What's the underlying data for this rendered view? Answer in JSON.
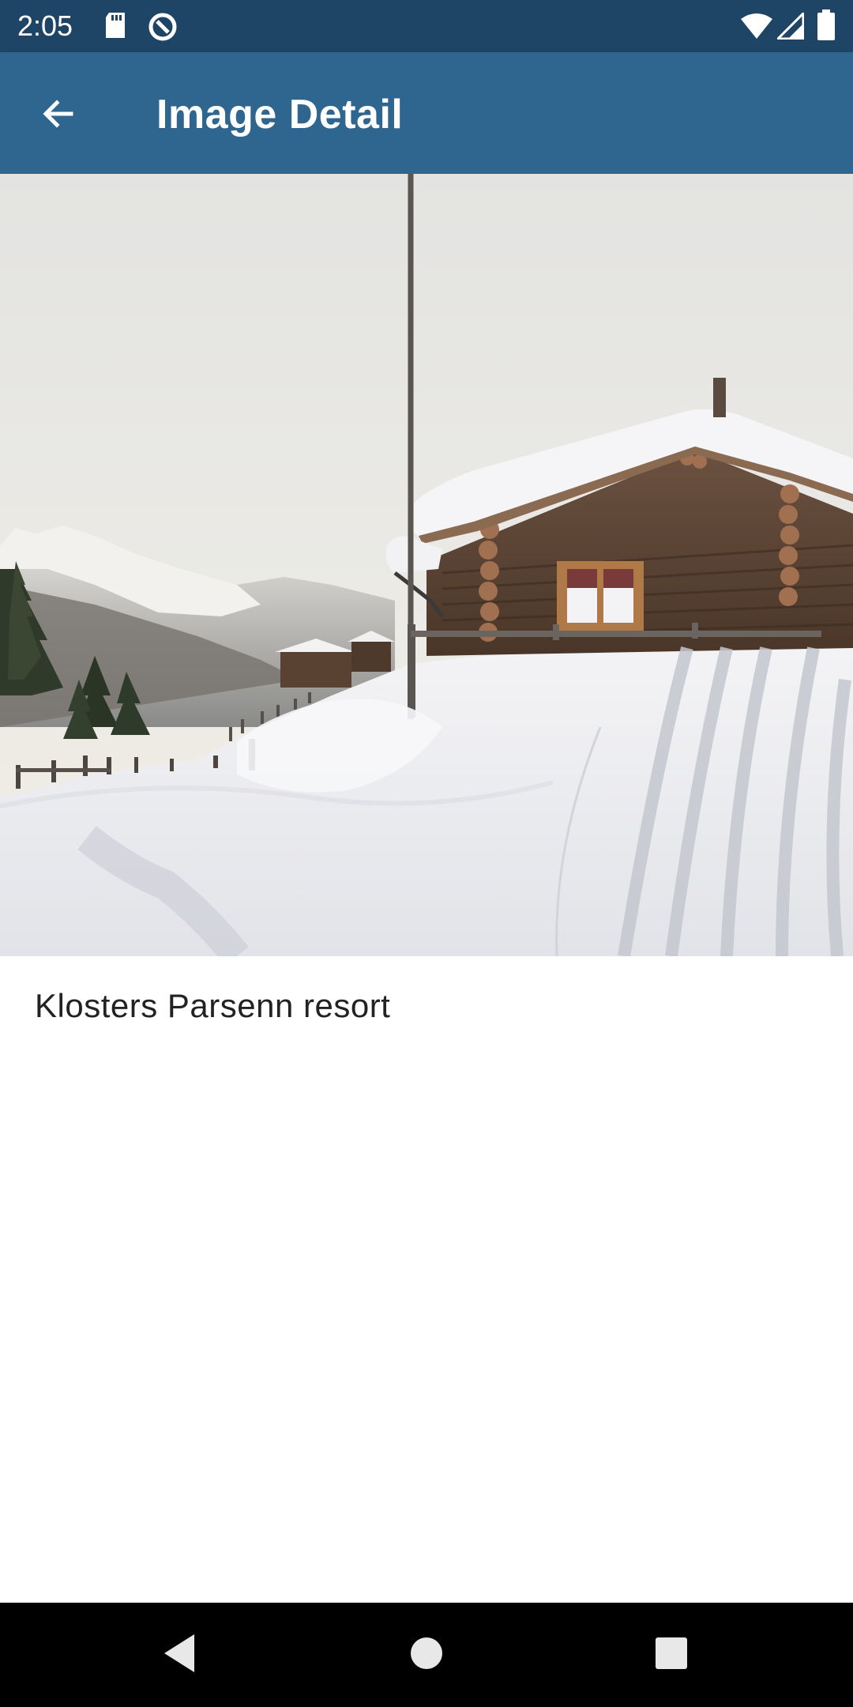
{
  "status_bar": {
    "time": "2:05",
    "left_icons": [
      "sd-card-icon",
      "data-saver-icon"
    ],
    "right_icons": [
      "wifi-icon",
      "cell-signal-icon",
      "battery-icon"
    ],
    "background": "#1f4566"
  },
  "app_bar": {
    "title": "Image Detail",
    "back_icon": "arrow-back-icon",
    "background": "#2e668f"
  },
  "image": {
    "caption": "Klosters Parsenn resort"
  },
  "nav_bar": {
    "buttons": [
      "back-triangle-icon",
      "home-circle-icon",
      "recents-square-icon"
    ]
  }
}
